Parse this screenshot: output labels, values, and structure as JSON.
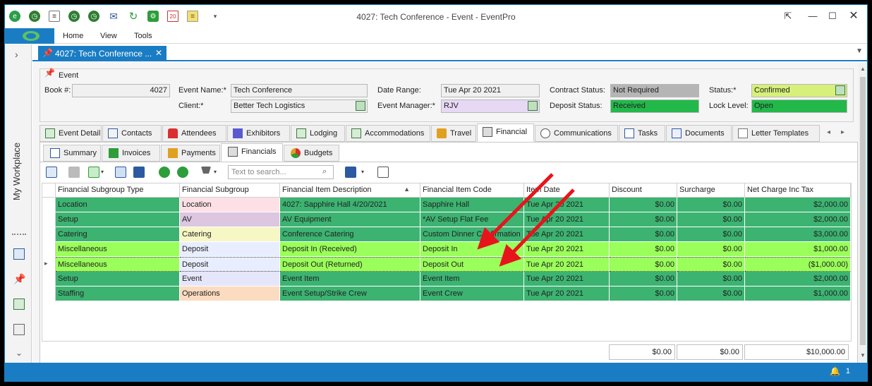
{
  "window": {
    "title": "4027: Tech Conference - Event - EventPro"
  },
  "ribbon": {
    "tabs": [
      "Home",
      "View",
      "Tools"
    ]
  },
  "sidebar": {
    "label": "My Workplace"
  },
  "document_tab": {
    "label": "4027: Tech Conference ..."
  },
  "event": {
    "group_label": "Event",
    "book_label": "Book #:",
    "book_value": "4027",
    "name_label": "Event Name:*",
    "name_value": "Tech Conference",
    "client_label": "Client:*",
    "client_value": "Better Tech Logistics",
    "date_label": "Date Range:",
    "date_value": "Tue Apr 20 2021",
    "manager_label": "Event Manager:*",
    "manager_value": "RJV",
    "contract_label": "Contract Status:",
    "contract_value": "Not Required",
    "deposit_label": "Deposit Status:",
    "deposit_value": "Received",
    "status_label": "Status:*",
    "status_value": "Confirmed",
    "lock_label": "Lock Level:",
    "lock_value": "Open"
  },
  "main_tabs": [
    "Event Detail",
    "Contacts",
    "Attendees",
    "Exhibitors",
    "Lodging",
    "Accommodations",
    "Travel",
    "Financial",
    "Communications",
    "Tasks",
    "Documents",
    "Letter Templates"
  ],
  "sub_tabs": [
    "Summary",
    "Invoices",
    "Payments",
    "Financials",
    "Budgets"
  ],
  "search": {
    "placeholder": "Text to search..."
  },
  "grid": {
    "columns": [
      "Financial Subgroup Type",
      "Financial Subgroup",
      "Financial Item Description",
      "Financial Item Code",
      "Item Date",
      "Discount",
      "Surcharge",
      "Net Charge Inc Tax"
    ],
    "rows": [
      [
        "Location",
        "Location",
        "4027: Sapphire Hall 4/20/2021",
        "Sapphire Hall",
        "Tue Apr 20 2021",
        "$0.00",
        "$0.00",
        "$2,000.00"
      ],
      [
        "Setup",
        "AV",
        "AV Equipment",
        "*AV Setup Flat Fee",
        "Tue Apr 20 2021",
        "$0.00",
        "$0.00",
        "$2,000.00"
      ],
      [
        "Catering",
        "Catering",
        "Conference Catering",
        "Custom Dinner Confirmation",
        "Tue Apr 20 2021",
        "$0.00",
        "$0.00",
        "$3,000.00"
      ],
      [
        "Miscellaneous",
        "Deposit",
        "Deposit In (Received)",
        "Deposit In",
        "Tue Apr 20 2021",
        "$0.00",
        "$0.00",
        "$1,000.00"
      ],
      [
        "Miscellaneous",
        "Deposit",
        "Deposit Out (Returned)",
        "Deposit Out",
        "Tue Apr 20 2021",
        "$0.00",
        "$0.00",
        "($1,000.00)"
      ],
      [
        "Setup",
        "Event",
        "Event Item",
        "Event Item",
        "Tue Apr 20 2021",
        "$0.00",
        "$0.00",
        "$2,000.00"
      ],
      [
        "Staffing",
        "Operations",
        "Event Setup/Strike Crew",
        "Event Crew",
        "Tue Apr 20 2021",
        "$0.00",
        "$0.00",
        "$1,000.00"
      ]
    ],
    "totals": {
      "discount": "$0.00",
      "surcharge": "$0.00",
      "net": "$10,000.00"
    }
  },
  "statusbar": {
    "notification_count": "1"
  },
  "colors": {
    "row_green": "#3cb371",
    "row_lime": "#9aff5a",
    "accent": "#1a7dc4",
    "arrow": "#e8141b"
  }
}
